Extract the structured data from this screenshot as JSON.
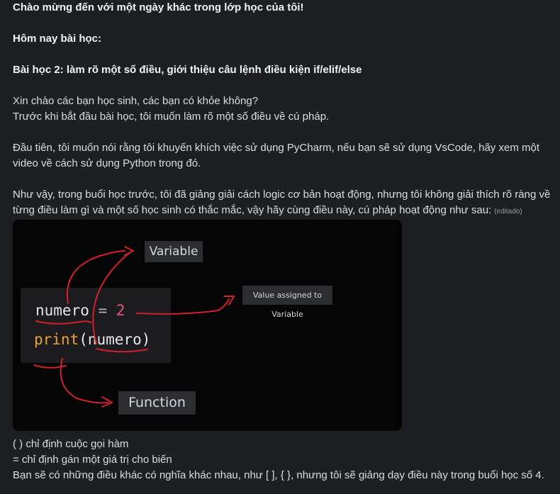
{
  "message": {
    "greeting": "Chào mừng đến với một ngày khác trong lớp học của tôi!",
    "today_label": "Hôm nay bài học:",
    "lesson_title": "Bài học 2: làm rõ một số điều, giới thiệu câu lệnh điều kiện if/elif/else",
    "p1_line1": "Xin chào các bạn học sinh, các bạn có khỏe không?",
    "p1_line2": "Trước khi bắt đầu bài học, tôi muốn làm rõ một số điều về cú pháp.",
    "p2_line1": "Đầu tiên, tôi muốn nói rằng tôi khuyến khích việc sử dụng PyCharm, nếu bạn sẽ sử dụng VsCode, hãy xem một",
    "p2_line2": "video về cách sử dụng Python trong đó.",
    "p3_line1": "Như vậy, trong buổi học trước, tôi đã giảng giải cách logic cơ bản hoạt động, nhưng tôi không giải thích rõ ràng về",
    "p3_line2": "từng điều làm gì và một số học sinh có thắc mắc, vậy hãy cùng điều này, cú pháp hoạt động như sau:",
    "edited_tag": "(editado)",
    "after1": "( ) chỉ định cuộc gọi hàm",
    "after2": "= chỉ định gán một giá trị cho biến",
    "after3": "Bạn sẽ có những điều khác có nghĩa khác nhau, như [ ], { }, nhưng tôi sẽ giảng dạy điều này trong buổi học số 4."
  },
  "attachment": {
    "code_line1": {
      "var": "numero",
      "op": " = ",
      "num": "2"
    },
    "code_line2": {
      "fn": "print",
      "rest": "(numero)"
    },
    "label_variable": "Variable",
    "label_value": "Value assigned to Variable",
    "label_function": "Function",
    "colors": {
      "var": "#e6e6e6",
      "op": "#a9b7c6",
      "number": "#e05a7f",
      "function": "#f0a030",
      "arrow": "#d2202e"
    }
  }
}
